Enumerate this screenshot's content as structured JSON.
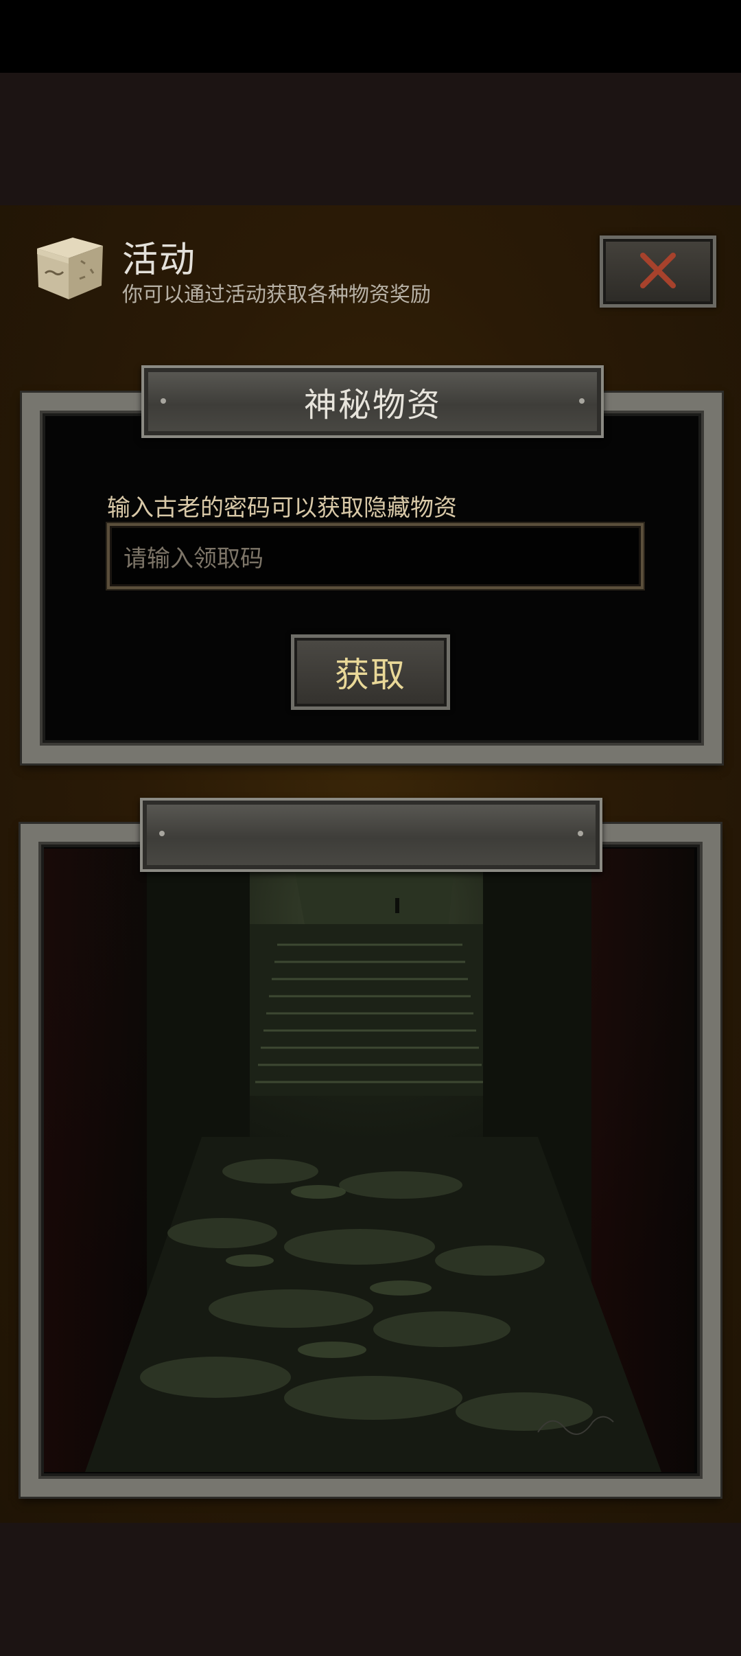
{
  "header": {
    "title": "活动",
    "subtitle": "你可以通过活动获取各种物资奖励",
    "icon": "box-icon",
    "close_icon": "close-x-icon"
  },
  "secret_panel": {
    "title": "神秘物资",
    "label": "输入古老的密码可以获取隐藏物资",
    "input_placeholder": "请输入领取码",
    "input_value": "",
    "button_label": "获取"
  },
  "colors": {
    "accent_gold": "#e9d898",
    "close_x": "#a7422c",
    "panel_bg": "#2a1a06"
  }
}
